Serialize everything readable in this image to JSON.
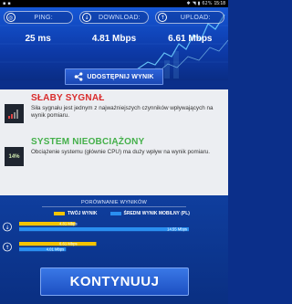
{
  "status_bar": {
    "time": "15:18",
    "battery": "62%"
  },
  "metrics": [
    {
      "icon": "ping-icon",
      "label": "PING:",
      "value": "25 ms"
    },
    {
      "icon": "download-icon",
      "label": "DOWNLOAD:",
      "value": "4.81 Mbps"
    },
    {
      "icon": "upload-icon",
      "label": "UPLOAD:",
      "value": "6.61 Mbps"
    }
  ],
  "share": {
    "label": "UDOSTĘPNIJ WYNIK"
  },
  "signal": {
    "badge_icon": "signal-bars-icon",
    "title": "SŁABY SYGNAŁ",
    "description": "Siła sygnału jest jednym z najważniejszych czynników wpływających na wynik pomiaru."
  },
  "system": {
    "badge": "14%",
    "title": "SYSTEM NIEOBCIĄŻONY",
    "description": "Obciążenie systemu (głównie CPU) ma duży wpływ na wynik pomiaru."
  },
  "comparison": {
    "title": "PORÓWNANIE WYNIKÓW",
    "legend": {
      "yours": "TWÓJ WYNIK",
      "average": "ŚREDNI WYNIK MOBILNY (PL)"
    },
    "colors": {
      "yours": "#f5c400",
      "average": "#2a8ff0"
    },
    "chart_data": {
      "type": "bar",
      "categories": [
        "download",
        "upload"
      ],
      "series": [
        {
          "name": "TWÓJ WYNIK",
          "values": [
            4.81,
            6.61
          ],
          "labels": [
            "4.81 Mbps",
            "6.61 Mbps"
          ]
        },
        {
          "name": "ŚREDNI WYNIK MOBILNY (PL)",
          "values": [
            14.55,
            4.01
          ],
          "labels": [
            "14.55 Mbps",
            "4.01 Mbps"
          ]
        }
      ]
    }
  },
  "continue": {
    "label": "KONTYNUUJ"
  }
}
